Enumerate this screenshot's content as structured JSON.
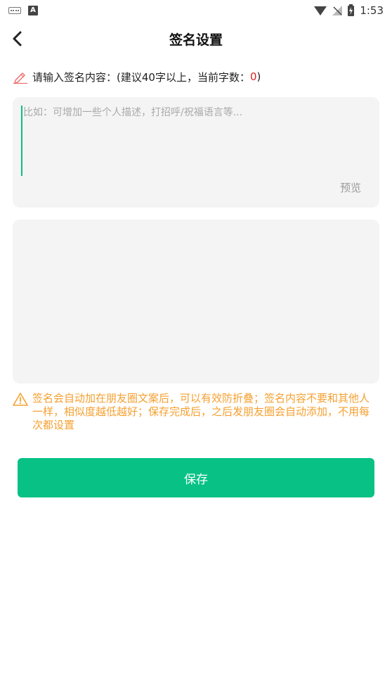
{
  "status_bar": {
    "time": "1:53",
    "icons": [
      "keyboard-icon",
      "a-badge-icon",
      "wifi-icon",
      "no-signal-icon",
      "battery-charging-icon"
    ]
  },
  "nav": {
    "title": "签名设置",
    "back_icon": "chevron-left-icon"
  },
  "hint": {
    "prefix": "请输入签名内容：(建议40字以上，当前字数：",
    "count": "0",
    "suffix": ")",
    "icon": "pencil-icon"
  },
  "input": {
    "value": "",
    "placeholder": "比如：可增加一些个人描述，打招呼/祝福语言等...",
    "preview_label": "预览"
  },
  "warning": {
    "icon": "warning-triangle-icon",
    "text": "签名会自动加在朋友圈文案后，可以有效防折叠；签名内容不要和其他人一样，相似度越低越好；保存完成后，之后发朋友圈会自动添加，不用每次都设置"
  },
  "save_button": {
    "label": "保存"
  },
  "colors": {
    "accent": "#07c284",
    "warning": "#f5a030",
    "count": "#e02020",
    "box_bg": "#f4f4f4"
  }
}
